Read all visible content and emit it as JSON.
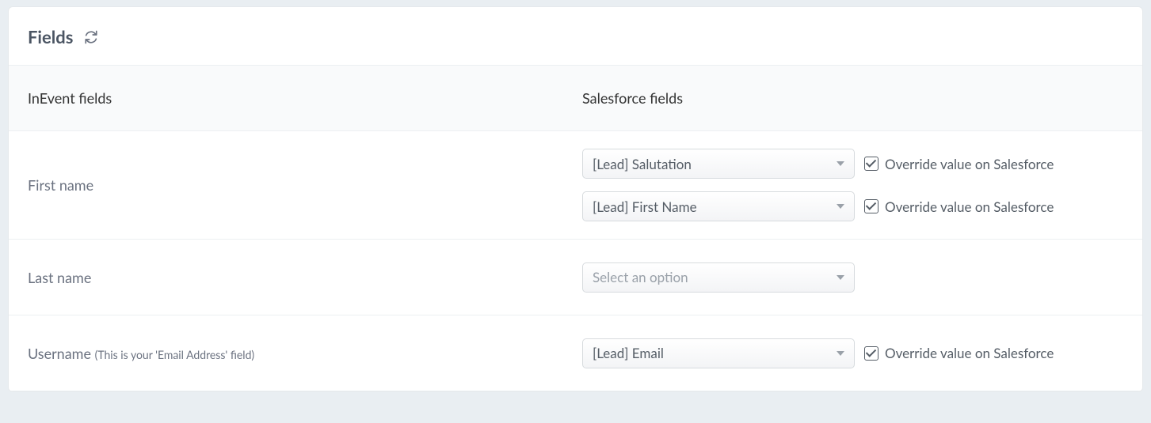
{
  "header": {
    "title": "Fields"
  },
  "columns": {
    "left": "InEvent fields",
    "right": "Salesforce fields"
  },
  "override_label": "Override value on Salesforce",
  "placeholder": "Select an option",
  "rows": [
    {
      "label": "First name",
      "hint": "",
      "mappings": [
        {
          "value": "[Lead] Salutation",
          "override": true
        },
        {
          "value": "[Lead] First Name",
          "override": true
        }
      ]
    },
    {
      "label": "Last name",
      "hint": "",
      "mappings": [
        {
          "value": "",
          "override": null
        }
      ]
    },
    {
      "label": "Username",
      "hint": "(This is your 'Email Address' field)",
      "mappings": [
        {
          "value": "[Lead] Email",
          "override": true
        }
      ]
    }
  ]
}
